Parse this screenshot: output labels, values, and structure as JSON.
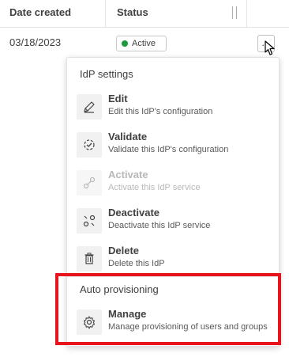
{
  "table": {
    "headers": {
      "date_created": "Date created",
      "status": "Status"
    },
    "row": {
      "date_created": "03/18/2023",
      "status": "Active",
      "status_color": "#1a9a3b",
      "more_label": "…"
    }
  },
  "menu": {
    "section_idp": "IdP settings",
    "items": [
      {
        "label": "Edit",
        "description": "Edit this IdP's configuration",
        "icon": "pencil-icon",
        "enabled": true
      },
      {
        "label": "Validate",
        "description": "Validate this IdP's configuration",
        "icon": "validate-icon",
        "enabled": true
      },
      {
        "label": "Activate",
        "description": "Activate this IdP service",
        "icon": "link-icon",
        "enabled": false
      },
      {
        "label": "Deactivate",
        "description": "Deactivate this IdP service",
        "icon": "unlink-icon",
        "enabled": true
      },
      {
        "label": "Delete",
        "description": "Delete this IdP",
        "icon": "trash-icon",
        "enabled": true
      }
    ],
    "section_auto": "Auto provisioning",
    "manage": {
      "label": "Manage",
      "description": "Manage provisioning of users and groups",
      "icon": "gear-icon",
      "enabled": true
    }
  },
  "colors": {
    "highlight": "#e8141b",
    "accent_green": "#1a9a3b"
  }
}
